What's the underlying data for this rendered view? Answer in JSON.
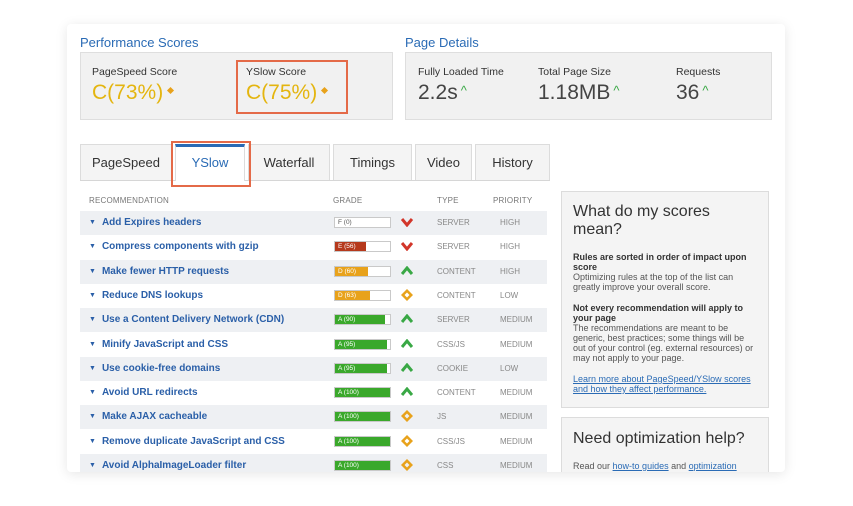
{
  "performance": {
    "title": "Performance Scores",
    "pagespeed": {
      "label": "PageSpeed Score",
      "grade": "C",
      "pct": "(73%)"
    },
    "yslow": {
      "label": "YSlow Score",
      "grade": "C",
      "pct": "(75%)"
    }
  },
  "details": {
    "title": "Page Details",
    "items": [
      {
        "label": "Fully Loaded Time",
        "value": "2.2s"
      },
      {
        "label": "Total Page Size",
        "value": "1.18MB"
      },
      {
        "label": "Requests",
        "value": "36"
      }
    ]
  },
  "tabs": [
    "PageSpeed",
    "YSlow",
    "Waterfall",
    "Timings",
    "Video",
    "History"
  ],
  "table": {
    "headers": {
      "recommendation": "RECOMMENDATION",
      "grade": "GRADE",
      "type": "TYPE",
      "priority": "PRIORITY"
    },
    "rows": [
      {
        "name": "Add Expires headers",
        "grade": "F (0)",
        "score": 0,
        "trend": "down",
        "type": "SERVER",
        "priority": "HIGH"
      },
      {
        "name": "Compress components with gzip",
        "grade": "E (56)",
        "score": 56,
        "trend": "down",
        "type": "SERVER",
        "priority": "HIGH"
      },
      {
        "name": "Make fewer HTTP requests",
        "grade": "D (60)",
        "score": 60,
        "trend": "up",
        "type": "CONTENT",
        "priority": "HIGH"
      },
      {
        "name": "Reduce DNS lookups",
        "grade": "D (63)",
        "score": 63,
        "trend": "neutral",
        "type": "CONTENT",
        "priority": "LOW"
      },
      {
        "name": "Use a Content Delivery Network (CDN)",
        "grade": "A (90)",
        "score": 90,
        "trend": "up",
        "type": "SERVER",
        "priority": "MEDIUM"
      },
      {
        "name": "Minify JavaScript and CSS",
        "grade": "A (95)",
        "score": 95,
        "trend": "up",
        "type": "CSS/JS",
        "priority": "MEDIUM"
      },
      {
        "name": "Use cookie-free domains",
        "grade": "A (95)",
        "score": 95,
        "trend": "up",
        "type": "COOKIE",
        "priority": "LOW"
      },
      {
        "name": "Avoid URL redirects",
        "grade": "A (100)",
        "score": 100,
        "trend": "up",
        "type": "CONTENT",
        "priority": "MEDIUM"
      },
      {
        "name": "Make AJAX cacheable",
        "grade": "A (100)",
        "score": 100,
        "trend": "neutral",
        "type": "JS",
        "priority": "MEDIUM"
      },
      {
        "name": "Remove duplicate JavaScript and CSS",
        "grade": "A (100)",
        "score": 100,
        "trend": "neutral",
        "type": "CSS/JS",
        "priority": "MEDIUM"
      },
      {
        "name": "Avoid AlphaImageLoader filter",
        "grade": "A (100)",
        "score": 100,
        "trend": "neutral",
        "type": "CSS",
        "priority": "MEDIUM"
      }
    ]
  },
  "sidebar": {
    "scores": {
      "title": "What do my scores mean?",
      "b1": "Rules are sorted in order of impact upon score",
      "p1": "Optimizing rules at the top of the list can greatly improve your overall score.",
      "b2": "Not every recommendation will apply to your page",
      "p2": "The recommendations are meant to be generic, best practices; some things will be out of your control (eg. external resources) or may not apply to your page.",
      "link": "Learn more about PageSpeed/YSlow scores and how they affect performance."
    },
    "help": {
      "title": "Need optimization help?",
      "text_start": "Read our",
      "link1": "how-to guides",
      "text_mid": "and",
      "link2": "optimization"
    }
  },
  "colors": {
    "accent": "#2a6bb5",
    "grade_a": "#3aa82b",
    "grade_d": "#e8a21b",
    "grade_e": "#b5391c",
    "grade_f": "#c0392b",
    "highlight": "#e46a48"
  }
}
